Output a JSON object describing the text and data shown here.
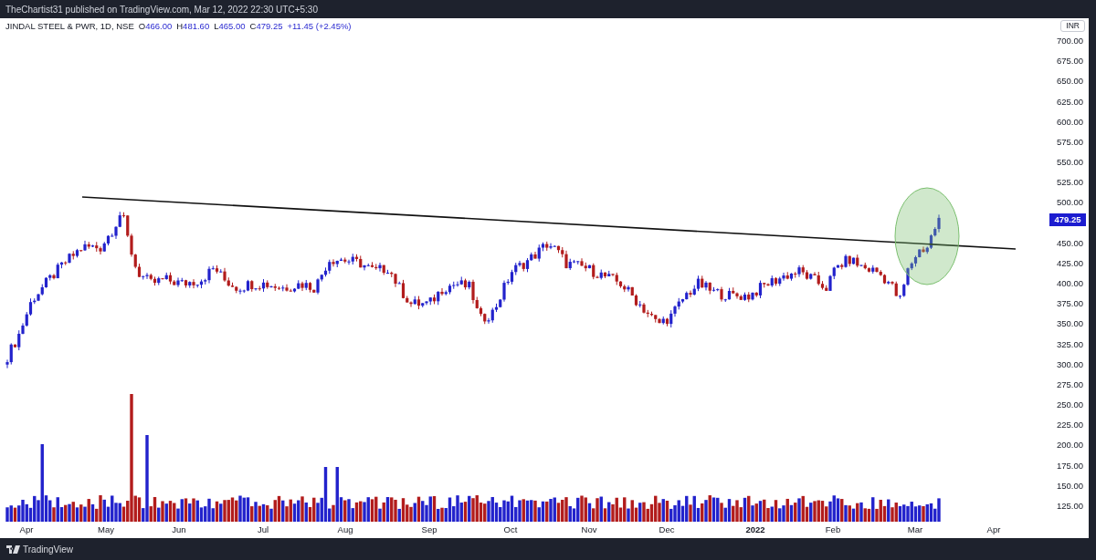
{
  "header": {
    "text": "TheChartist31 published on TradingView.com, Mar 12, 2022 22:30 UTC+5:30"
  },
  "legend": {
    "symbol": "JINDAL STEEL & PWR, 1D, NSE",
    "fields": [
      {
        "label": "O",
        "value": "466.00"
      },
      {
        "label": "H",
        "value": "481.60"
      },
      {
        "label": "L",
        "value": "465.00"
      },
      {
        "label": "C",
        "value": "479.25"
      }
    ],
    "change": "+11.45 (+2.45%)"
  },
  "price_axis": {
    "currency": "INR",
    "last_price": "479.25",
    "ticks": [
      "700.00",
      "675.00",
      "650.00",
      "625.00",
      "600.00",
      "575.00",
      "550.00",
      "525.00",
      "500.00",
      "450.00",
      "425.00",
      "400.00",
      "375.00",
      "350.00",
      "325.00",
      "300.00",
      "275.00",
      "250.00",
      "225.00",
      "200.00",
      "175.00",
      "150.00",
      "125.00"
    ]
  },
  "time_axis": {
    "labels": [
      {
        "text": "Apr",
        "bold": false
      },
      {
        "text": "May",
        "bold": false
      },
      {
        "text": "Jun",
        "bold": false
      },
      {
        "text": "Jul",
        "bold": false
      },
      {
        "text": "Aug",
        "bold": false
      },
      {
        "text": "Sep",
        "bold": false
      },
      {
        "text": "Oct",
        "bold": false
      },
      {
        "text": "Nov",
        "bold": false
      },
      {
        "text": "Dec",
        "bold": false
      },
      {
        "text": "2022",
        "bold": true
      },
      {
        "text": "Feb",
        "bold": false
      },
      {
        "text": "Mar",
        "bold": false
      },
      {
        "text": "Apr",
        "bold": false
      }
    ]
  },
  "footer": {
    "brand": "TradingView"
  }
}
